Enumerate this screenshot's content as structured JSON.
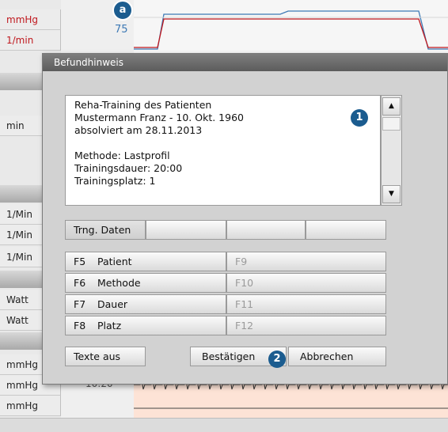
{
  "background": {
    "unit_labels": [
      {
        "text": "mmHg",
        "color": "red"
      },
      {
        "text": "1/min",
        "color": "red"
      },
      {
        "text": "min",
        "color": "default"
      },
      {
        "text": "1/Min",
        "color": "default"
      },
      {
        "text": "1/Min",
        "color": "default"
      },
      {
        "text": "1/Min",
        "color": "default"
      },
      {
        "text": "Watt",
        "color": "default"
      },
      {
        "text": "Watt",
        "color": "default"
      },
      {
        "text": "mmHg",
        "color": "default"
      },
      {
        "text": "mmHg",
        "color": "default"
      },
      {
        "text": "mmHg",
        "color": "default"
      }
    ],
    "scale_value": "75",
    "time_label": "10:20",
    "callout_a": "a"
  },
  "dialog": {
    "title": "Befundhinweis",
    "text_lines": [
      "Reha-Training des Patienten",
      "Mustermann Franz - 10. Okt. 1960",
      "absolviert am 28.11.2013",
      "",
      "Methode: Lastprofil",
      "Trainingsdauer: 20:00",
      "Trainingsplatz: 1"
    ],
    "callout_1": "1",
    "callout_2": "2",
    "scroll_up_icon": "▲",
    "scroll_down_icon": "▼",
    "tabs": [
      "Trng. Daten",
      "",
      "",
      ""
    ],
    "function_keys_left": [
      {
        "key": "F5",
        "label": "Patient"
      },
      {
        "key": "F6",
        "label": "Methode"
      },
      {
        "key": "F7",
        "label": "Dauer"
      },
      {
        "key": "F8",
        "label": "Platz"
      }
    ],
    "function_keys_right": [
      "F9",
      "F10",
      "F11",
      "F12"
    ],
    "texts_off_label": "Texte aus",
    "confirm_label": "Bestätigen",
    "cancel_label": "Abbrechen"
  },
  "colors": {
    "accent_badge": "#1b5c8f",
    "alarm_red": "#c0181e",
    "scale_blue": "#3d79b5",
    "ecg_background": "#fde3d6"
  }
}
